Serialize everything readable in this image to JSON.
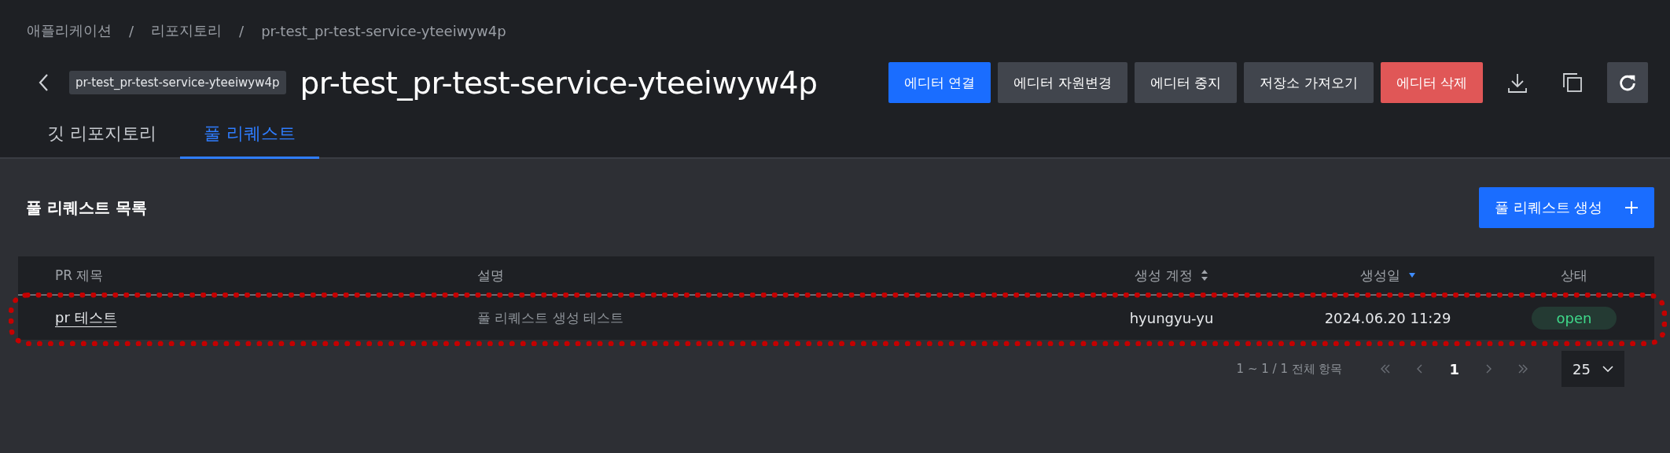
{
  "breadcrumbs": [
    "애플리케이션",
    "리포지토리",
    "pr-test_pr-test-service-yteeiwyw4p"
  ],
  "breadcrumb_separator": "/",
  "header": {
    "repo_chip": "pr-test_pr-test-service-yteeiwyw4p",
    "title": "pr-test_pr-test-service-yteeiwyw4p",
    "actions": [
      {
        "label": "에디터 연결",
        "kind": "primary"
      },
      {
        "label": "에디터 자원변경",
        "kind": "secondary"
      },
      {
        "label": "에디터 중지",
        "kind": "secondary"
      },
      {
        "label": "저장소 가져오기",
        "kind": "secondary"
      },
      {
        "label": "에디터 삭제",
        "kind": "danger"
      }
    ],
    "icon_buttons": [
      {
        "kind": "download"
      },
      {
        "kind": "copy"
      },
      {
        "kind": "refresh"
      }
    ]
  },
  "tabs": [
    {
      "label": "깃 리포지토리",
      "selected": false
    },
    {
      "label": "풀 리퀘스트",
      "selected": true
    }
  ],
  "section": {
    "title": "풀 리퀘스트 목록",
    "create_button": "풀 리퀘스트 생성"
  },
  "table": {
    "columns": [
      {
        "label": "PR 제목",
        "kind": "plain"
      },
      {
        "label": "설명",
        "kind": "plain"
      },
      {
        "label": "생성 계정",
        "kind": "sortable"
      },
      {
        "label": "생성일",
        "kind": "sorted_desc"
      },
      {
        "label": "상태",
        "kind": "plain"
      }
    ],
    "rows": [
      {
        "title": "pr 테스트",
        "description": "풀 리퀘스트 생성 테스트",
        "account": "hyungyu-yu",
        "created": "2024.06.20 11:29",
        "status": "open",
        "highlighted": true
      }
    ]
  },
  "pagination": {
    "summary": "1 ~ 1 / 1 전체 항목",
    "pages": [
      {
        "label": "1",
        "selected": true
      }
    ],
    "page_size": "25"
  }
}
